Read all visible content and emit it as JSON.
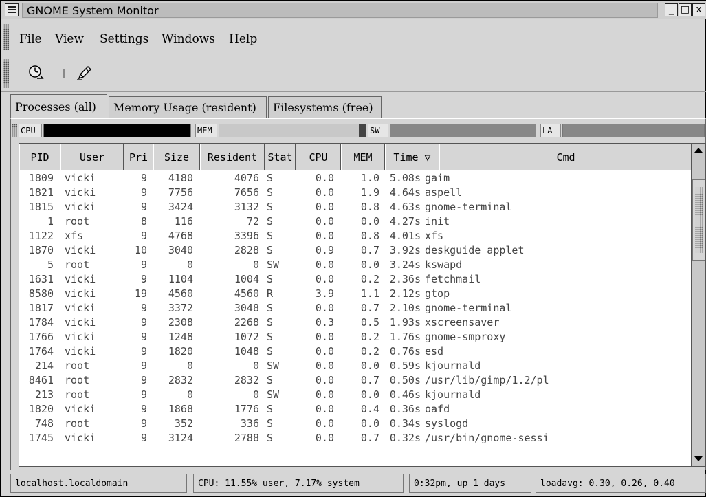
{
  "window": {
    "title": "GNOME System Monitor",
    "controls": [
      "_",
      "□",
      "x"
    ]
  },
  "menubar": {
    "items": [
      {
        "label": "File"
      },
      {
        "label": "View"
      },
      {
        "label": "Settings"
      },
      {
        "label": "Windows"
      },
      {
        "label": "Help"
      }
    ]
  },
  "toolbar": {
    "icons": [
      "clock-refresh-icon",
      "pencil-edit-icon"
    ]
  },
  "tabs": [
    {
      "label": "Processes (all)",
      "active": true
    },
    {
      "label": "Memory Usage (resident)",
      "active": false
    },
    {
      "label": "Filesystems (free)",
      "active": false
    }
  ],
  "meters": {
    "cpu": {
      "label": "CPU",
      "color": "#000000"
    },
    "mem": {
      "label": "MEM",
      "color": "#c8c8c8",
      "fill_color": "#444444"
    },
    "sw": {
      "label": "SW",
      "color": "#888888"
    },
    "la": {
      "label": "LA",
      "color": "#888888"
    }
  },
  "table": {
    "columns": [
      "PID",
      "User",
      "Pri",
      "Size",
      "Resident",
      "Stat",
      "CPU",
      "MEM",
      "Time ▽",
      "Cmd"
    ],
    "rows": [
      [
        "1809",
        "vicki",
        "9",
        "4180",
        "4076",
        "S",
        "0.0",
        "1.0",
        "5.08s",
        "gaim"
      ],
      [
        "1821",
        "vicki",
        "9",
        "7756",
        "7656",
        "S",
        "0.0",
        "1.9",
        "4.64s",
        "aspell"
      ],
      [
        "1815",
        "vicki",
        "9",
        "3424",
        "3132",
        "S",
        "0.0",
        "0.8",
        "4.63s",
        "gnome-terminal"
      ],
      [
        "1",
        "root",
        "8",
        "116",
        "72",
        "S",
        "0.0",
        "0.0",
        "4.27s",
        "init"
      ],
      [
        "1122",
        "xfs",
        "9",
        "4768",
        "3396",
        "S",
        "0.0",
        "0.8",
        "4.01s",
        "xfs"
      ],
      [
        "1870",
        "vicki",
        "10",
        "3040",
        "2828",
        "S",
        "0.9",
        "0.7",
        "3.92s",
        "deskguide_applet"
      ],
      [
        "5",
        "root",
        "9",
        "0",
        "0",
        "SW",
        "0.0",
        "0.0",
        "3.24s",
        "kswapd"
      ],
      [
        "1631",
        "vicki",
        "9",
        "1104",
        "1004",
        "S",
        "0.0",
        "0.2",
        "2.36s",
        "fetchmail"
      ],
      [
        "8580",
        "vicki",
        "19",
        "4560",
        "4560",
        "R",
        "3.9",
        "1.1",
        "2.12s",
        "gtop"
      ],
      [
        "1817",
        "vicki",
        "9",
        "3372",
        "3048",
        "S",
        "0.0",
        "0.7",
        "2.10s",
        "gnome-terminal"
      ],
      [
        "1784",
        "vicki",
        "9",
        "2308",
        "2268",
        "S",
        "0.3",
        "0.5",
        "1.93s",
        "xscreensaver"
      ],
      [
        "1766",
        "vicki",
        "9",
        "1248",
        "1072",
        "S",
        "0.0",
        "0.2",
        "1.76s",
        "gnome-smproxy"
      ],
      [
        "1764",
        "vicki",
        "9",
        "1820",
        "1048",
        "S",
        "0.0",
        "0.2",
        "0.76s",
        "esd"
      ],
      [
        "214",
        "root",
        "9",
        "0",
        "0",
        "SW",
        "0.0",
        "0.0",
        "0.59s",
        "kjournald"
      ],
      [
        "8461",
        "root",
        "9",
        "2832",
        "2832",
        "S",
        "0.0",
        "0.7",
        "0.50s",
        "/usr/lib/gimp/1.2/pl"
      ],
      [
        "213",
        "root",
        "9",
        "0",
        "0",
        "SW",
        "0.0",
        "0.0",
        "0.46s",
        "kjournald"
      ],
      [
        "1820",
        "vicki",
        "9",
        "1868",
        "1776",
        "S",
        "0.0",
        "0.4",
        "0.36s",
        "oafd"
      ],
      [
        "748",
        "root",
        "9",
        "352",
        "336",
        "S",
        "0.0",
        "0.0",
        "0.34s",
        "syslogd"
      ],
      [
        "1745",
        "vicki",
        "9",
        "3124",
        "2788",
        "S",
        "0.0",
        "0.7",
        "0.32s",
        "/usr/bin/gnome-sessi"
      ]
    ]
  },
  "statusbar": {
    "host": "localhost.localdomain",
    "cpu": "CPU: 11.55% user,  7.17% system",
    "uptime": "0:32pm, up 1 days",
    "loadavg": "loadavg: 0.30, 0.26, 0.40"
  }
}
